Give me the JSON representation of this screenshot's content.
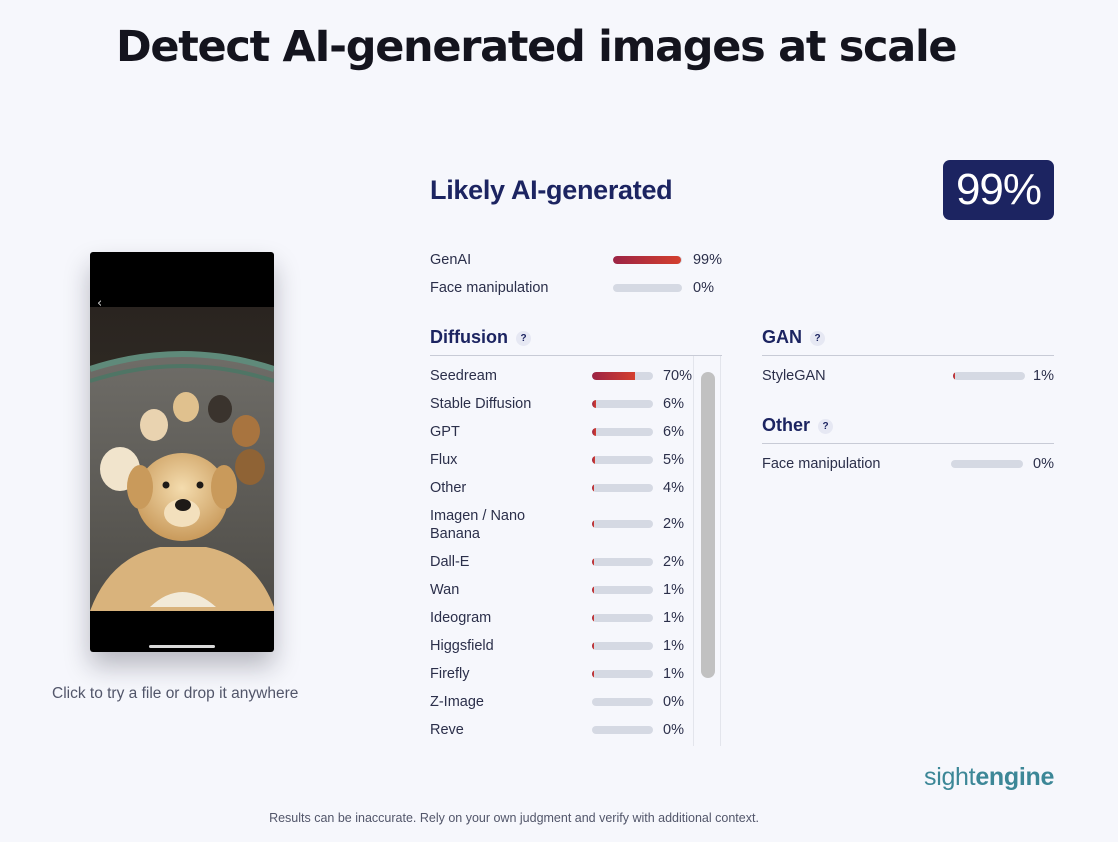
{
  "headline": "Detect AI-generated images at scale",
  "upload": {
    "back_glyph": "‹",
    "hint": "Click to try a file or drop it anywhere"
  },
  "verdict": {
    "title": "Likely AI-generated",
    "score": "99%"
  },
  "summary": [
    {
      "label": "GenAI",
      "value": 99,
      "pct": "99%"
    },
    {
      "label": "Face manipulation",
      "value": 0,
      "pct": "0%"
    }
  ],
  "sections": {
    "diffusion": {
      "title": "Diffusion",
      "help": "?",
      "items": [
        {
          "label": "Seedream",
          "value": 70,
          "pct": "70%"
        },
        {
          "label": "Stable Diffusion",
          "value": 6,
          "pct": "6%"
        },
        {
          "label": "GPT",
          "value": 6,
          "pct": "6%"
        },
        {
          "label": "Flux",
          "value": 5,
          "pct": "5%"
        },
        {
          "label": "Other",
          "value": 4,
          "pct": "4%"
        },
        {
          "label": "Imagen / Nano Banana",
          "value": 2,
          "pct": "2%"
        },
        {
          "label": "Dall-E",
          "value": 2,
          "pct": "2%"
        },
        {
          "label": "Wan",
          "value": 1,
          "pct": "1%"
        },
        {
          "label": "Ideogram",
          "value": 1,
          "pct": "1%"
        },
        {
          "label": "Higgsfield",
          "value": 1,
          "pct": "1%"
        },
        {
          "label": "Firefly",
          "value": 1,
          "pct": "1%"
        },
        {
          "label": "Z-Image",
          "value": 0,
          "pct": "0%"
        },
        {
          "label": "Reve",
          "value": 0,
          "pct": "0%"
        }
      ]
    },
    "gan": {
      "title": "GAN",
      "help": "?",
      "items": [
        {
          "label": "StyleGAN",
          "value": 1,
          "pct": "1%"
        }
      ]
    },
    "other": {
      "title": "Other",
      "help": "?",
      "items": [
        {
          "label": "Face manipulation",
          "value": 0,
          "pct": "0%"
        }
      ]
    }
  },
  "brand": {
    "light": "sight",
    "bold": "engine"
  },
  "footer": "Results can be inaccurate. Rely on your own judgment and verify with additional context.",
  "colors": {
    "navy": "#1c2461",
    "bar_start": "#9c2445",
    "bar_end": "#d43f2e",
    "track": "#d5d9e3",
    "brand": "#3c8797"
  }
}
